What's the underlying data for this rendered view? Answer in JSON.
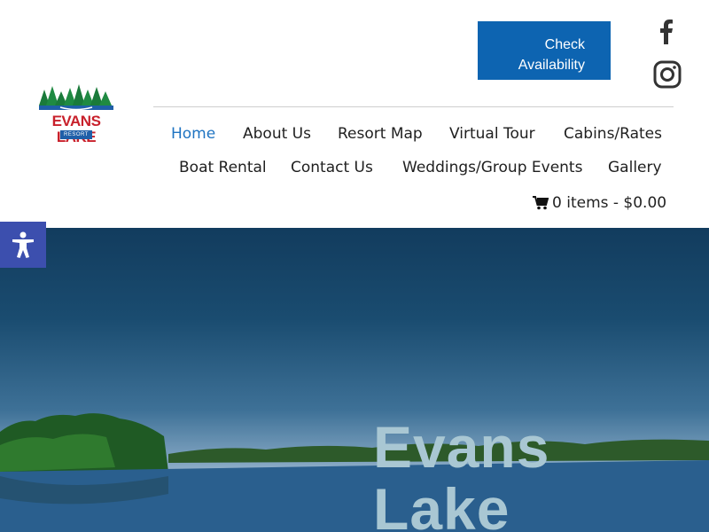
{
  "brand": {
    "name": "EVANS LAKE",
    "subtitle": "RESORT",
    "colors": {
      "primary": "#0d64b1",
      "accent_red": "#c8202b",
      "nav_active": "#1f74c2",
      "a11y": "#3c4fae"
    }
  },
  "header": {
    "cta_line1": "Check",
    "cta_line2": "Availability",
    "social": [
      {
        "icon": "facebook-icon"
      },
      {
        "icon": "instagram-icon"
      }
    ]
  },
  "nav": {
    "items": [
      {
        "label": "Home",
        "active": true
      },
      {
        "label": "About Us"
      },
      {
        "label": "Resort Map"
      },
      {
        "label": "Virtual Tour"
      },
      {
        "label": "Cabins/Rates"
      },
      {
        "label": "Boat Rental"
      },
      {
        "label": "Contact Us"
      },
      {
        "label": "Weddings/Group Events"
      },
      {
        "label": "Gallery"
      }
    ],
    "cart_label": "0 items - $0.00",
    "cart_icon": "shopping-cart-icon"
  },
  "hero": {
    "title_line1": "Evans",
    "title_line2": "Lake"
  },
  "accessibility": {
    "icon": "accessibility-icon"
  }
}
